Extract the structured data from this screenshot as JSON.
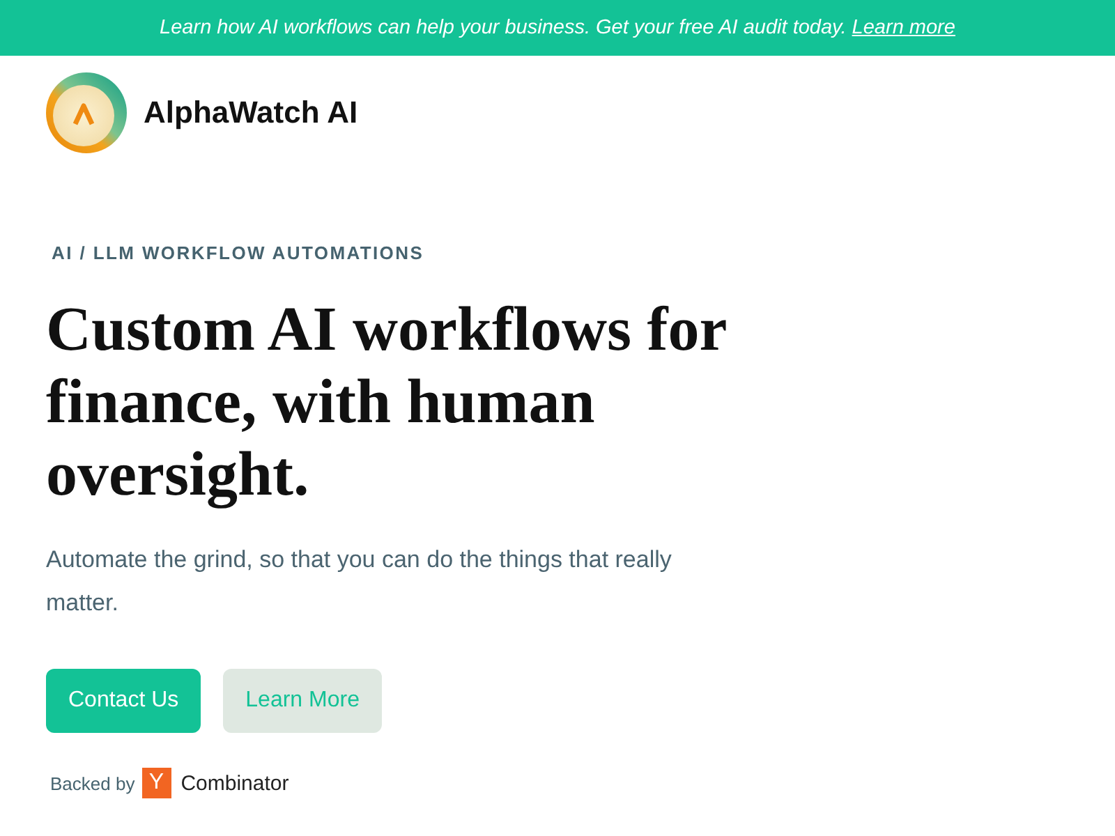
{
  "banner": {
    "text": "Learn how AI workflows can help your business. Get your free AI audit today.",
    "link": "Learn more"
  },
  "header": {
    "brand": "AlphaWatch AI"
  },
  "hero": {
    "eyebrow": "AI / LLM WORKFLOW AUTOMATIONS",
    "heading": "Custom AI workflows for finance, with human oversight.",
    "subtitle": "Automate the grind, so that you can do the things that really matter.",
    "buttons": [
      {
        "label": "Contact Us",
        "kind": "primary"
      },
      {
        "label": "Learn More",
        "kind": "secondary"
      }
    ],
    "backing": {
      "text": "Backed by",
      "logo_letter": "Y",
      "logo_name": "Combinator"
    }
  }
}
